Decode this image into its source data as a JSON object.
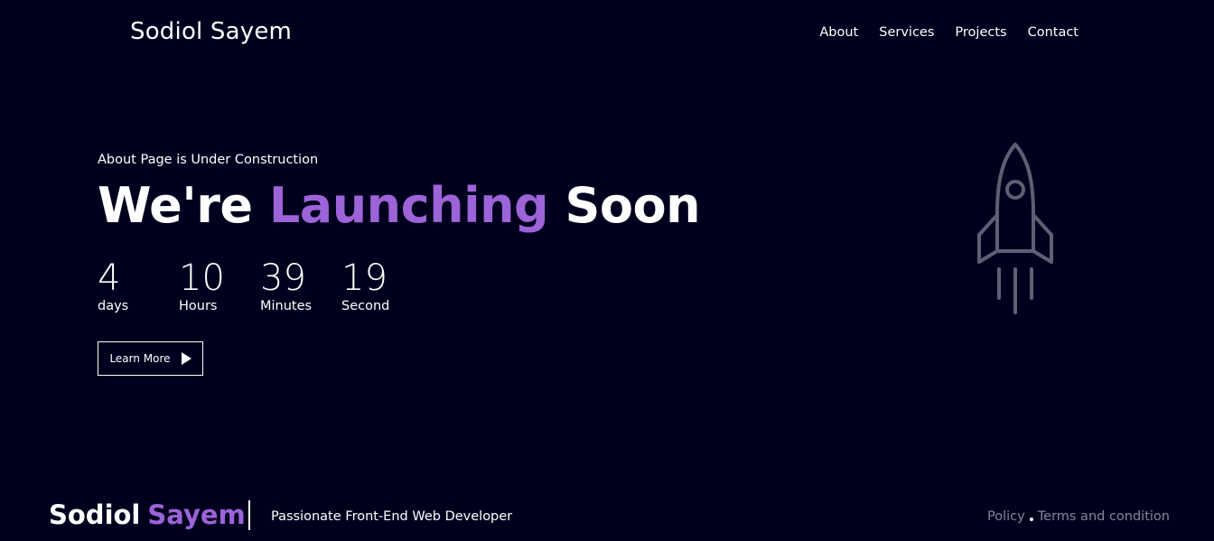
{
  "header": {
    "brand": "Sodiol Sayem",
    "nav": [
      "About",
      "Services",
      "Projects",
      "Contact"
    ]
  },
  "hero": {
    "eyebrow": "About Page is Under Construction",
    "headline_start": "We're",
    "headline_accent": "Launching",
    "headline_end": "Soon",
    "countdown": [
      {
        "value": "4",
        "unit": "days"
      },
      {
        "value": "10",
        "unit": "Hours"
      },
      {
        "value": "39",
        "unit": "Minutes"
      },
      {
        "value": "19",
        "unit": "Second"
      }
    ],
    "button_label": "Learn More",
    "button_icon": "play-icon",
    "illustration_icon": "rocket-icon"
  },
  "footer": {
    "brand_first": "Sodiol",
    "brand_accent": "Sayem",
    "tagline": "Passionate Front-End Web Developer",
    "links": [
      "Policy",
      "Terms and condition"
    ]
  },
  "colors": {
    "background": "#00001e",
    "accent": "#9d63d8",
    "text": "#ffffff",
    "muted": "#86869a"
  }
}
